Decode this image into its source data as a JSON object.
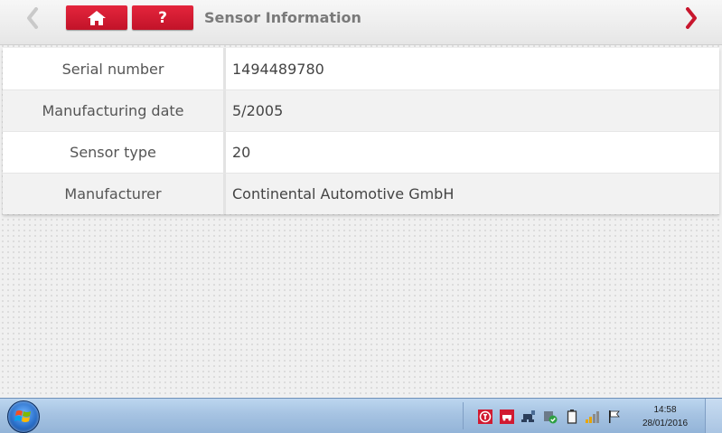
{
  "header": {
    "title": "Sensor Information",
    "help_label": "?"
  },
  "table": {
    "rows": [
      {
        "label": "Serial number",
        "value": "1494489780"
      },
      {
        "label": "Manufacturing date",
        "value": "5/2005"
      },
      {
        "label": "Sensor type",
        "value": "20"
      },
      {
        "label": "Manufacturer",
        "value": "Continental Automotive GmbH"
      }
    ]
  },
  "taskbar": {
    "time": "14:58",
    "date": "28/01/2016",
    "tray_icons": [
      "tachograph-icon",
      "vehicle-icon",
      "network-device-icon",
      "security-check-icon",
      "battery-icon",
      "signal-strength-icon",
      "flag-icon"
    ]
  },
  "colors": {
    "accent_red": "#d11a31",
    "header_text": "#7a7a7a"
  }
}
